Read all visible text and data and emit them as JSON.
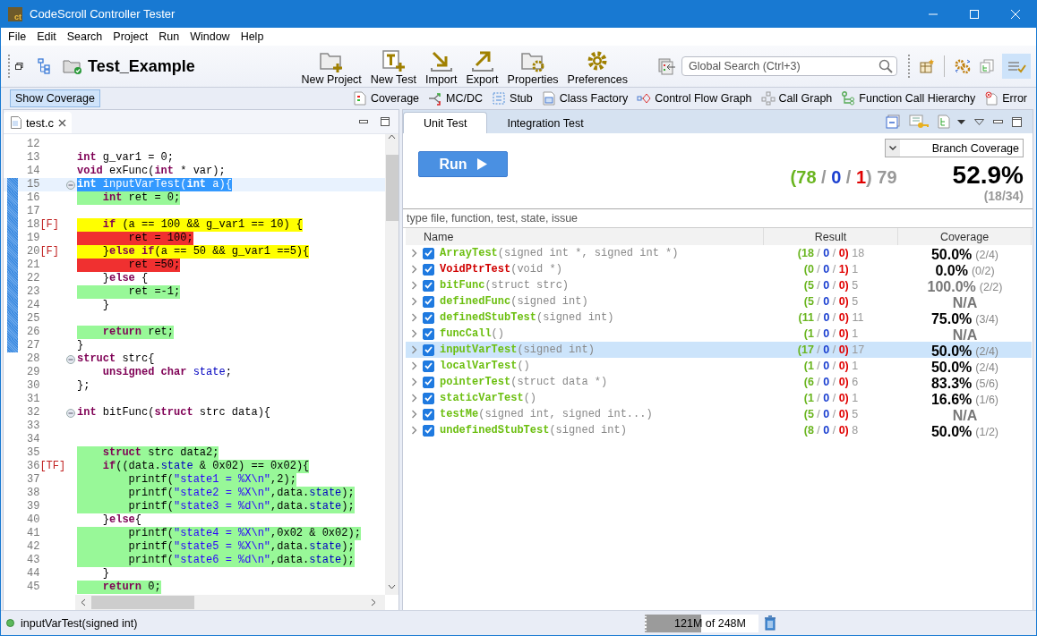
{
  "window": {
    "logo_text": "ct",
    "title": "CodeScroll Controller Tester"
  },
  "menu": [
    "File",
    "Edit",
    "Search",
    "Project",
    "Run",
    "Window",
    "Help"
  ],
  "toolbar": {
    "project": "Test_Example",
    "buttons": [
      {
        "label": "New Project",
        "kind": "new-project"
      },
      {
        "label": "New Test",
        "kind": "new-test"
      },
      {
        "label": "Import",
        "kind": "import"
      },
      {
        "label": "Export",
        "kind": "export"
      },
      {
        "label": "Properties",
        "kind": "properties"
      },
      {
        "label": "Preferences",
        "kind": "preferences"
      }
    ],
    "search": {
      "placeholder": "Global Search (Ctrl+3)"
    },
    "layout_toggle": {
      "selected": true
    }
  },
  "coverage_bar": {
    "show_coverage": {
      "label": "Show Coverage",
      "selected": true
    },
    "views": [
      {
        "label": "Coverage",
        "kind": "coverage"
      },
      {
        "label": "MC/DC",
        "kind": "mcdc"
      },
      {
        "label": "Stub",
        "kind": "stub"
      },
      {
        "label": "Class Factory",
        "kind": "class-factory"
      },
      {
        "label": "Control Flow Graph",
        "kind": "flow"
      },
      {
        "label": "Call Graph",
        "kind": "call-graph"
      },
      {
        "label": "Function Call Hierarchy",
        "kind": "hierarchy"
      },
      {
        "label": "Error",
        "kind": "error"
      }
    ]
  },
  "editor": {
    "tab": "test.c",
    "lines": [
      {
        "n": "12",
        "fold": false,
        "range": false,
        "kind": "plain"
      },
      {
        "n": "13",
        "fold": false,
        "range": false,
        "kind": "plain",
        "tokens": [
          {
            "kind": "keyword",
            "text": "int"
          },
          {
            "kind": "plain",
            "text": " g_var1 = 0;"
          }
        ]
      },
      {
        "n": "14",
        "fold": false,
        "range": false,
        "kind": "plain",
        "tokens": [
          {
            "kind": "keyword",
            "text": "void"
          },
          {
            "kind": "plain",
            "text": " exFunc("
          },
          {
            "kind": "keyword",
            "text": "int"
          },
          {
            "kind": "plain",
            "text": " * var);"
          }
        ]
      },
      {
        "n": "15",
        "fold": true,
        "range": true,
        "kind": "selection",
        "tokens": [
          {
            "kind": "keyword",
            "text": "int"
          },
          {
            "kind": "plain",
            "text": " inputVarTest("
          },
          {
            "kind": "keyword",
            "text": "int"
          },
          {
            "kind": "plain",
            "text": " a){"
          }
        ]
      },
      {
        "n": "16",
        "fold": false,
        "range": true,
        "kind": "covered",
        "tokens": [
          {
            "kind": "keyword",
            "text": "    int"
          },
          {
            "kind": "plain",
            "text": " ret = 0;"
          }
        ]
      },
      {
        "n": "17",
        "fold": false,
        "range": true,
        "kind": "plain"
      },
      {
        "n": "18",
        "marker": "[F]",
        "fold": false,
        "range": true,
        "kind": "partial",
        "tokens": [
          {
            "kind": "keyword",
            "text": "    if"
          },
          {
            "kind": "plain",
            "text": " (a == 100 && g_var1 == 10) {"
          }
        ]
      },
      {
        "n": "19",
        "fold": false,
        "range": true,
        "kind": "uncovered",
        "tokens": [
          {
            "kind": "plain",
            "text": "        ret = 100;"
          }
        ]
      },
      {
        "n": "20",
        "marker": "[F]",
        "fold": false,
        "range": true,
        "kind": "partial",
        "tokens": [
          {
            "kind": "plain",
            "text": "    }"
          },
          {
            "kind": "keyword",
            "text": "else"
          },
          {
            "kind": "keyword",
            "text": " if"
          },
          {
            "kind": "plain",
            "text": "(a == 50 && g_var1 ==5){"
          }
        ]
      },
      {
        "n": "21",
        "fold": false,
        "range": true,
        "kind": "uncovered",
        "tokens": [
          {
            "kind": "plain",
            "text": "        ret =50;"
          }
        ]
      },
      {
        "n": "22",
        "fold": false,
        "range": true,
        "kind": "plain",
        "tokens": [
          {
            "kind": "plain",
            "text": "    }"
          },
          {
            "kind": "keyword",
            "text": "else"
          },
          {
            "kind": "plain",
            "text": " {"
          }
        ]
      },
      {
        "n": "23",
        "fold": false,
        "range": true,
        "kind": "covered",
        "tokens": [
          {
            "kind": "plain",
            "text": "        ret =-1;"
          }
        ]
      },
      {
        "n": "24",
        "fold": false,
        "range": true,
        "kind": "plain",
        "tokens": [
          {
            "kind": "plain",
            "text": "    }"
          }
        ]
      },
      {
        "n": "25",
        "fold": false,
        "range": true,
        "kind": "plain"
      },
      {
        "n": "26",
        "fold": false,
        "range": true,
        "kind": "covered",
        "tokens": [
          {
            "kind": "keyword",
            "text": "    return"
          },
          {
            "kind": "plain",
            "text": " ret;"
          }
        ]
      },
      {
        "n": "27",
        "fold": false,
        "range": true,
        "kind": "plain",
        "tokens": [
          {
            "kind": "plain",
            "text": "}"
          }
        ]
      },
      {
        "n": "28",
        "fold": true,
        "range": false,
        "kind": "plain",
        "tokens": [
          {
            "kind": "keyword",
            "text": "struct"
          },
          {
            "kind": "plain",
            "text": " strc{"
          }
        ]
      },
      {
        "n": "29",
        "fold": false,
        "range": false,
        "kind": "plain",
        "tokens": [
          {
            "kind": "keyword",
            "text": "    unsigned"
          },
          {
            "kind": "keyword",
            "text": " char"
          },
          {
            "kind": "field",
            "text": " state"
          },
          {
            "kind": "plain",
            "text": ";"
          }
        ]
      },
      {
        "n": "30",
        "fold": false,
        "range": false,
        "kind": "plain",
        "tokens": [
          {
            "kind": "plain",
            "text": "};"
          }
        ]
      },
      {
        "n": "31",
        "fold": false,
        "range": false,
        "kind": "plain"
      },
      {
        "n": "32",
        "fold": true,
        "range": false,
        "kind": "plain",
        "tokens": [
          {
            "kind": "keyword",
            "text": "int"
          },
          {
            "kind": "plain",
            "text": " bitFunc("
          },
          {
            "kind": "keyword",
            "text": "struct"
          },
          {
            "kind": "plain",
            "text": " strc data){"
          }
        ]
      },
      {
        "n": "33",
        "fold": false,
        "range": false,
        "kind": "plain"
      },
      {
        "n": "34",
        "fold": false,
        "range": false,
        "kind": "plain"
      },
      {
        "n": "35",
        "fold": false,
        "range": false,
        "kind": "covered",
        "tokens": [
          {
            "kind": "keyword",
            "text": "    struct"
          },
          {
            "kind": "plain",
            "text": " strc data2;"
          }
        ]
      },
      {
        "n": "36",
        "marker": "[TF]",
        "fold": false,
        "range": false,
        "kind": "covered",
        "tokens": [
          {
            "kind": "keyword",
            "text": "    if"
          },
          {
            "kind": "plain",
            "text": "((data."
          },
          {
            "kind": "field",
            "text": "state"
          },
          {
            "kind": "plain",
            "text": " & 0x02) == 0x02){"
          }
        ]
      },
      {
        "n": "37",
        "fold": false,
        "range": false,
        "kind": "covered",
        "tokens": [
          {
            "kind": "plain",
            "text": "        printf("
          },
          {
            "kind": "string",
            "text": "\"state1 = %X\\n\""
          },
          {
            "kind": "plain",
            "text": ",2);"
          }
        ]
      },
      {
        "n": "38",
        "fold": false,
        "range": false,
        "kind": "covered",
        "tokens": [
          {
            "kind": "plain",
            "text": "        printf("
          },
          {
            "kind": "string",
            "text": "\"state2 = %X\\n\""
          },
          {
            "kind": "plain",
            "text": ",data."
          },
          {
            "kind": "field",
            "text": "state"
          },
          {
            "kind": "plain",
            "text": ");"
          }
        ]
      },
      {
        "n": "39",
        "fold": false,
        "range": false,
        "kind": "covered",
        "tokens": [
          {
            "kind": "plain",
            "text": "        printf("
          },
          {
            "kind": "string",
            "text": "\"state3 = %d\\n\""
          },
          {
            "kind": "plain",
            "text": ",data."
          },
          {
            "kind": "field",
            "text": "state"
          },
          {
            "kind": "plain",
            "text": ");"
          }
        ]
      },
      {
        "n": "40",
        "fold": false,
        "range": false,
        "kind": "plain",
        "tokens": [
          {
            "kind": "plain",
            "text": "    }"
          },
          {
            "kind": "keyword",
            "text": "else"
          },
          {
            "kind": "plain",
            "text": "{"
          }
        ]
      },
      {
        "n": "41",
        "fold": false,
        "range": false,
        "kind": "covered",
        "tokens": [
          {
            "kind": "plain",
            "text": "        printf("
          },
          {
            "kind": "string",
            "text": "\"state4 = %X\\n\""
          },
          {
            "kind": "plain",
            "text": ",0x02 & 0x02);"
          }
        ]
      },
      {
        "n": "42",
        "fold": false,
        "range": false,
        "kind": "covered",
        "tokens": [
          {
            "kind": "plain",
            "text": "        printf("
          },
          {
            "kind": "string",
            "text": "\"state5 = %X\\n\""
          },
          {
            "kind": "plain",
            "text": ",data."
          },
          {
            "kind": "field",
            "text": "state"
          },
          {
            "kind": "plain",
            "text": ");"
          }
        ]
      },
      {
        "n": "43",
        "fold": false,
        "range": false,
        "kind": "covered",
        "tokens": [
          {
            "kind": "plain",
            "text": "        printf("
          },
          {
            "kind": "string",
            "text": "\"state6 = %d\\n\""
          },
          {
            "kind": "plain",
            "text": ",data."
          },
          {
            "kind": "field",
            "text": "state"
          },
          {
            "kind": "plain",
            "text": ");"
          }
        ]
      },
      {
        "n": "44",
        "fold": false,
        "range": false,
        "kind": "plain",
        "tokens": [
          {
            "kind": "plain",
            "text": "    }"
          }
        ]
      },
      {
        "n": "45",
        "fold": false,
        "range": false,
        "kind": "covered",
        "tokens": [
          {
            "kind": "keyword",
            "text": "    return"
          },
          {
            "kind": "plain",
            "text": " 0;"
          }
        ]
      }
    ]
  },
  "test_panel": {
    "tabs": [
      {
        "label": "Unit Test",
        "selected": true
      },
      {
        "label": "Integration Test",
        "selected": false
      }
    ],
    "run_label": "Run",
    "coverage_type": "Branch Coverage",
    "summary": [
      {
        "kind": "pass",
        "text": "(78"
      },
      {
        "kind": "sep",
        "text": " / "
      },
      {
        "kind": "error",
        "text": "0"
      },
      {
        "kind": "sep",
        "text": " / "
      },
      {
        "kind": "fail",
        "text": "1"
      },
      {
        "kind": "sep",
        "text": ")"
      },
      {
        "kind": "total",
        "text": " 79"
      }
    ],
    "percent": "52.9%",
    "fraction": "(18/34)",
    "filter": {
      "placeholder": "type file, function, test, state, issue"
    },
    "columns": [
      "Name",
      "Result",
      "Coverage"
    ],
    "rows": [
      {
        "name": "ArrayTest",
        "params": "(signed int *, signed int *)",
        "failed": false,
        "checked": true,
        "expanded": false,
        "selected": false,
        "pass": "(18",
        "error": "0",
        "fail": "0)",
        "total": "18",
        "percent": "50.0%",
        "fraction": "(2/4)",
        "greyed": false
      },
      {
        "name": "VoidPtrTest",
        "params": "(void *)",
        "failed": true,
        "checked": true,
        "expanded": false,
        "selected": false,
        "pass": "(0",
        "error": "0",
        "fail": "1)",
        "total": "1",
        "percent": "0.0%",
        "fraction": "(0/2)",
        "greyed": false
      },
      {
        "name": "bitFunc",
        "params": "(struct strc)",
        "failed": false,
        "checked": true,
        "expanded": false,
        "selected": false,
        "pass": "(5",
        "error": "0",
        "fail": "0)",
        "total": "5",
        "percent": "100.0%",
        "fraction": "(2/2)",
        "greyed": true
      },
      {
        "name": "definedFunc",
        "params": "(signed int)",
        "failed": false,
        "checked": true,
        "expanded": false,
        "selected": false,
        "pass": "(5",
        "error": "0",
        "fail": "0)",
        "total": "5",
        "percent": "N/A",
        "greyed": true
      },
      {
        "name": "definedStubTest",
        "params": "(signed int)",
        "failed": false,
        "checked": true,
        "expanded": false,
        "selected": false,
        "pass": "(11",
        "error": "0",
        "fail": "0)",
        "total": "11",
        "percent": "75.0%",
        "fraction": "(3/4)",
        "greyed": false
      },
      {
        "name": "funcCall",
        "params": "()",
        "failed": false,
        "checked": true,
        "expanded": false,
        "selected": false,
        "pass": "(1",
        "error": "0",
        "fail": "0)",
        "total": "1",
        "percent": "N/A",
        "greyed": true
      },
      {
        "name": "inputVarTest",
        "params": "(signed int)",
        "failed": false,
        "checked": true,
        "expanded": false,
        "selected": true,
        "pass": "(17",
        "error": "0",
        "fail": "0)",
        "total": "17",
        "percent": "50.0%",
        "fraction": "(2/4)",
        "greyed": false
      },
      {
        "name": "localVarTest",
        "params": "()",
        "failed": false,
        "checked": true,
        "expanded": false,
        "selected": false,
        "pass": "(1",
        "error": "0",
        "fail": "0)",
        "total": "1",
        "percent": "50.0%",
        "fraction": "(2/4)",
        "greyed": false
      },
      {
        "name": "pointerTest",
        "params": "(struct data *)",
        "failed": false,
        "checked": true,
        "expanded": false,
        "selected": false,
        "pass": "(6",
        "error": "0",
        "fail": "0)",
        "total": "6",
        "percent": "83.3%",
        "fraction": "(5/6)",
        "greyed": false
      },
      {
        "name": "staticVarTest",
        "params": "()",
        "failed": false,
        "checked": true,
        "expanded": false,
        "selected": false,
        "pass": "(1",
        "error": "0",
        "fail": "0)",
        "total": "1",
        "percent": "16.6%",
        "fraction": "(1/6)",
        "greyed": false
      },
      {
        "name": "testMe",
        "params": "(signed int, signed int...)",
        "failed": false,
        "checked": true,
        "expanded": false,
        "selected": false,
        "pass": "(5",
        "error": "0",
        "fail": "0)",
        "total": "5",
        "percent": "N/A",
        "greyed": true
      },
      {
        "name": "undefinedStubTest",
        "params": "(signed int)",
        "failed": false,
        "checked": true,
        "expanded": false,
        "selected": false,
        "pass": "(8",
        "error": "0",
        "fail": "0)",
        "total": "8",
        "percent": "50.0%",
        "fraction": "(1/2)",
        "greyed": false
      }
    ],
    "separator": "/"
  },
  "status_bar": {
    "message": "inputVarTest(signed int)",
    "memory": {
      "text": "121M of 248M",
      "level": 0.49
    }
  }
}
